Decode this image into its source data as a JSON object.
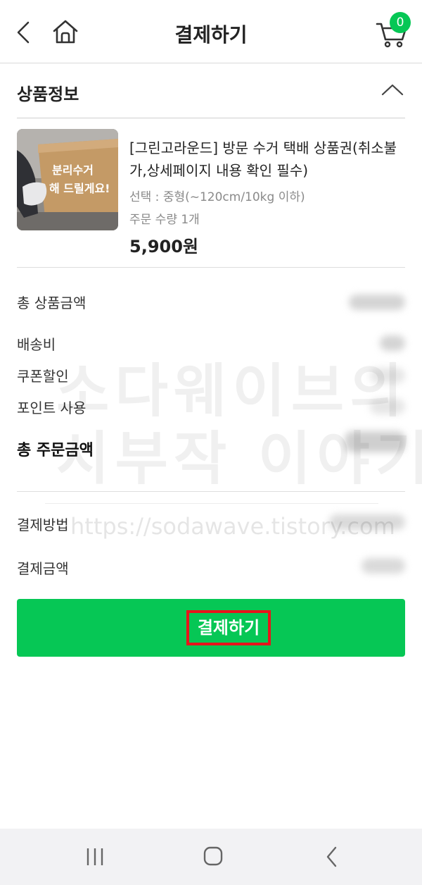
{
  "header": {
    "title": "결제하기",
    "back_icon": "chevron-left-icon",
    "home_icon": "home-icon",
    "cart_icon": "cart-icon",
    "cart_count": "0"
  },
  "product_section": {
    "title": "상품정보",
    "collapse_icon": "chevron-up-icon",
    "product": {
      "name": "[그린고라운드] 방문 수거 택배 상품권(취소불가,상세페이지 내용 확인 필수)",
      "option": "선택 : 중형(~120cm/10kg 이하)",
      "quantity": "주문 수량 1개",
      "price": "5,900원",
      "thumbnail_text_1": "분리수거",
      "thumbnail_text_2": "해 드릴게요!"
    }
  },
  "summary": {
    "total_product_amount_label": "총 상품금액",
    "shipping_label": "배송비",
    "coupon_label": "쿠폰할인",
    "points_label": "포인트 사용",
    "total_order_amount_label": "총 주문금액"
  },
  "payment": {
    "method_label": "결제방법",
    "amount_label": "결제금액",
    "pay_button_label": "결제하기"
  },
  "watermark": {
    "line1": "소다웨이브의",
    "line2": "시부작 이야기",
    "url": "https://sodawave.tistory.com"
  },
  "colors": {
    "accent_green": "#06c755",
    "highlight_red": "#e8141b"
  }
}
